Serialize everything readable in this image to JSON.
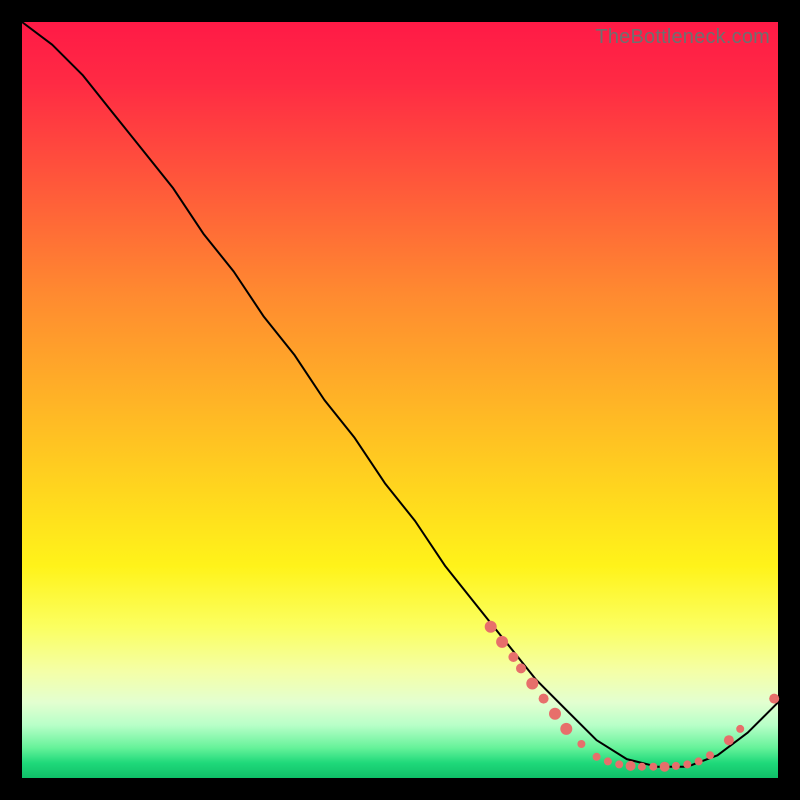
{
  "watermark": "TheBottleneck.com",
  "colors": {
    "dot": "#e76f6b",
    "line": "#000000",
    "page_bg": "#000000"
  },
  "chart_data": {
    "type": "line",
    "title": "",
    "xlabel": "",
    "ylabel": "",
    "xlim": [
      0,
      100
    ],
    "ylim": [
      0,
      100
    ],
    "grid": false,
    "legend": false,
    "series": [
      {
        "name": "bottleneck-curve",
        "x": [
          0,
          4,
          8,
          12,
          16,
          20,
          24,
          28,
          32,
          36,
          40,
          44,
          48,
          52,
          56,
          60,
          64,
          68,
          72,
          76,
          80,
          84,
          88,
          92,
          96,
          100
        ],
        "y": [
          100,
          97,
          93,
          88,
          83,
          78,
          72,
          67,
          61,
          56,
          50,
          45,
          39,
          34,
          28,
          23,
          18,
          13,
          9,
          5,
          2.5,
          1.5,
          1.5,
          3,
          6,
          10
        ]
      }
    ],
    "markers": [
      {
        "x": 62,
        "y": 20,
        "r": 6
      },
      {
        "x": 63.5,
        "y": 18,
        "r": 6
      },
      {
        "x": 65,
        "y": 16,
        "r": 5
      },
      {
        "x": 66,
        "y": 14.5,
        "r": 5
      },
      {
        "x": 67.5,
        "y": 12.5,
        "r": 6
      },
      {
        "x": 69,
        "y": 10.5,
        "r": 5
      },
      {
        "x": 70.5,
        "y": 8.5,
        "r": 6
      },
      {
        "x": 72,
        "y": 6.5,
        "r": 6
      },
      {
        "x": 74,
        "y": 4.5,
        "r": 4
      },
      {
        "x": 76,
        "y": 2.8,
        "r": 4
      },
      {
        "x": 77.5,
        "y": 2.2,
        "r": 4
      },
      {
        "x": 79,
        "y": 1.8,
        "r": 4
      },
      {
        "x": 80.5,
        "y": 1.6,
        "r": 5
      },
      {
        "x": 82,
        "y": 1.5,
        "r": 4
      },
      {
        "x": 83.5,
        "y": 1.5,
        "r": 4
      },
      {
        "x": 85,
        "y": 1.5,
        "r": 5
      },
      {
        "x": 86.5,
        "y": 1.6,
        "r": 4
      },
      {
        "x": 88,
        "y": 1.8,
        "r": 4
      },
      {
        "x": 89.5,
        "y": 2.2,
        "r": 4
      },
      {
        "x": 91,
        "y": 3.0,
        "r": 4
      },
      {
        "x": 93.5,
        "y": 5.0,
        "r": 5
      },
      {
        "x": 95,
        "y": 6.5,
        "r": 4
      },
      {
        "x": 99.5,
        "y": 10.5,
        "r": 5
      }
    ]
  }
}
